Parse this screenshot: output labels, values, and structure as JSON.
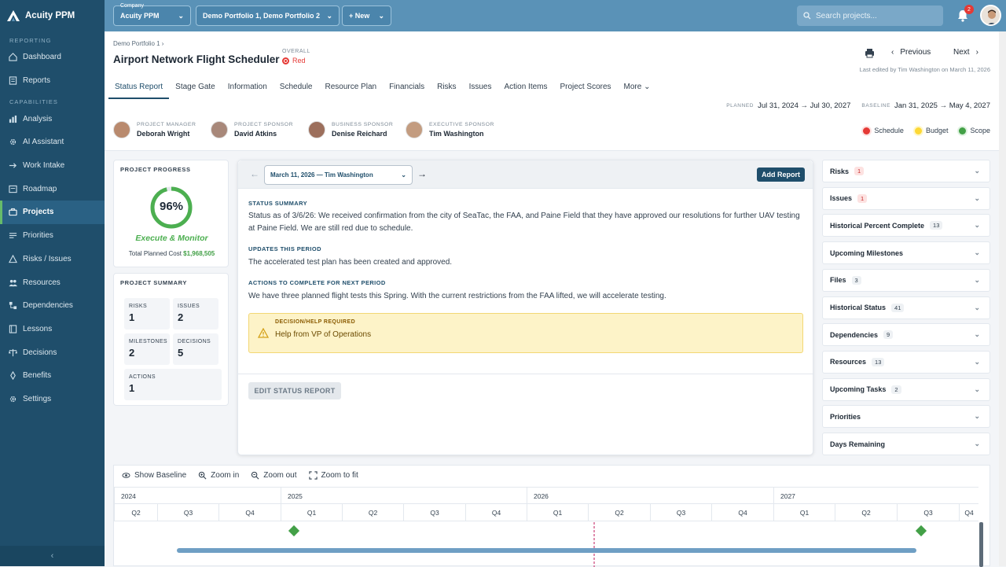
{
  "app": {
    "name": "Acuity PPM",
    "collapse": "‹"
  },
  "sidebar": {
    "reporting_label": "REPORTING",
    "capabilities_label": "CAPABILITIES",
    "reporting": [
      {
        "label": "Dashboard",
        "icon": "home-icon"
      },
      {
        "label": "Reports",
        "icon": "report-icon"
      }
    ],
    "capabilities": [
      {
        "label": "Analysis",
        "icon": "chart-icon"
      },
      {
        "label": "AI Assistant",
        "icon": "gear-icon"
      },
      {
        "label": "Work Intake",
        "icon": "intake-icon"
      },
      {
        "label": "Roadmap",
        "icon": "roadmap-icon"
      },
      {
        "label": "Projects",
        "icon": "briefcase-icon",
        "active": true
      },
      {
        "label": "Priorities",
        "icon": "list-icon"
      },
      {
        "label": "Risks / Issues",
        "icon": "risk-icon"
      },
      {
        "label": "Resources",
        "icon": "people-icon"
      },
      {
        "label": "Dependencies",
        "icon": "dependency-icon"
      },
      {
        "label": "Lessons",
        "icon": "book-icon"
      },
      {
        "label": "Decisions",
        "icon": "scale-icon"
      },
      {
        "label": "Benefits",
        "icon": "benefit-icon"
      },
      {
        "label": "Settings",
        "icon": "gear-icon"
      }
    ]
  },
  "topbar": {
    "company_caption": "Company",
    "company": "Acuity PPM",
    "portfolio": "Demo Portfolio 1, Demo Portfolio 2",
    "new_label": "+ New",
    "search_placeholder": "Search projects...",
    "notifications": "2"
  },
  "project": {
    "breadcrumb": "Demo Portfolio 1 ›",
    "title": "Airport Network Flight Scheduler",
    "overall_label": "OVERALL",
    "overall_value": "Red",
    "previous": "Previous",
    "next": "Next",
    "last_edited": "Last edited by Tim Washington on March 11, 2026",
    "tabs": [
      "Status Report",
      "Stage Gate",
      "Information",
      "Schedule",
      "Resource Plan",
      "Financials",
      "Risks",
      "Issues",
      "Action Items",
      "Project Scores",
      "More"
    ],
    "planned_label": "PLANNED",
    "planned": "Jul 31, 2024 → Jul 30, 2027",
    "baseline_label": "BASELINE",
    "baseline": "Jan 31, 2025 → May 4, 2027",
    "people": [
      {
        "role": "PROJECT MANAGER",
        "name": "Deborah Wright"
      },
      {
        "role": "PROJECT SPONSOR",
        "name": "David Atkins"
      },
      {
        "role": "BUSINESS SPONSOR",
        "name": "Denise Reichard"
      },
      {
        "role": "EXECUTIVE SPONSOR",
        "name": "Tim Washington"
      }
    ],
    "health": [
      {
        "label": "Schedule",
        "color": "#e53935"
      },
      {
        "label": "Budget",
        "color": "#fdd835"
      },
      {
        "label": "Scope",
        "color": "#43a047"
      }
    ]
  },
  "progress": {
    "title": "PROJECT PROGRESS",
    "percent": "96%",
    "percent_value": 96,
    "phase": "Execute & Monitor",
    "cost_label": "Total Planned Cost",
    "cost": "$1,968,505"
  },
  "summary": {
    "title": "PROJECT SUMMARY",
    "cells": [
      {
        "k": "RISKS",
        "v": "1"
      },
      {
        "k": "ISSUES",
        "v": "2"
      },
      {
        "k": "MILESTONES",
        "v": "2"
      },
      {
        "k": "DECISIONS",
        "v": "5"
      },
      {
        "k": "ACTIONS",
        "v": "1"
      }
    ]
  },
  "status": {
    "report_select": "March 11, 2026 — Tim Washington",
    "add_report": "Add Report",
    "summary_label": "STATUS SUMMARY",
    "summary": "Status as of 3/6/26:  We received confirmation from the city of SeaTac, the FAA, and Paine Field that they have approved our resolutions for further UAV testing at Paine Field. We are still red due to schedule.",
    "updates_label": "UPDATES THIS PERIOD",
    "updates": "The accelerated test plan has been created and approved.",
    "actions_label": "ACTIONS TO COMPLETE FOR NEXT PERIOD",
    "actions": "We have three planned flight tests this Spring. With the current restrictions from the FAA lifted, we will accelerate testing.",
    "decision_label": "DECISION/HELP REQUIRED",
    "decision": "Help from VP of Operations",
    "edit": "EDIT STATUS REPORT"
  },
  "accordion": [
    {
      "label": "Risks",
      "count": "1",
      "red": true
    },
    {
      "label": "Issues",
      "count": "1",
      "red": true
    },
    {
      "label": "Historical Percent Complete",
      "count": "13"
    },
    {
      "label": "Upcoming Milestones",
      "count": ""
    },
    {
      "label": "Files",
      "count": "3"
    },
    {
      "label": "Historical Status",
      "count": "41"
    },
    {
      "label": "Dependencies",
      "count": "9"
    },
    {
      "label": "Resources",
      "count": "13"
    },
    {
      "label": "Upcoming Tasks",
      "count": "2"
    },
    {
      "label": "Priorities",
      "count": ""
    },
    {
      "label": "Days Remaining",
      "count": ""
    }
  ],
  "gantt": {
    "tools": [
      "Show Baseline",
      "Zoom in",
      "Zoom out",
      "Zoom to fit"
    ],
    "years": [
      "2024",
      "2025",
      "2026",
      "2027"
    ],
    "quarters": [
      "Q2",
      "Q3",
      "Q4",
      "Q1",
      "Q2",
      "Q3",
      "Q4",
      "Q1",
      "Q2",
      "Q3",
      "Q4",
      "Q1",
      "Q2",
      "Q3",
      "Q4"
    ]
  }
}
